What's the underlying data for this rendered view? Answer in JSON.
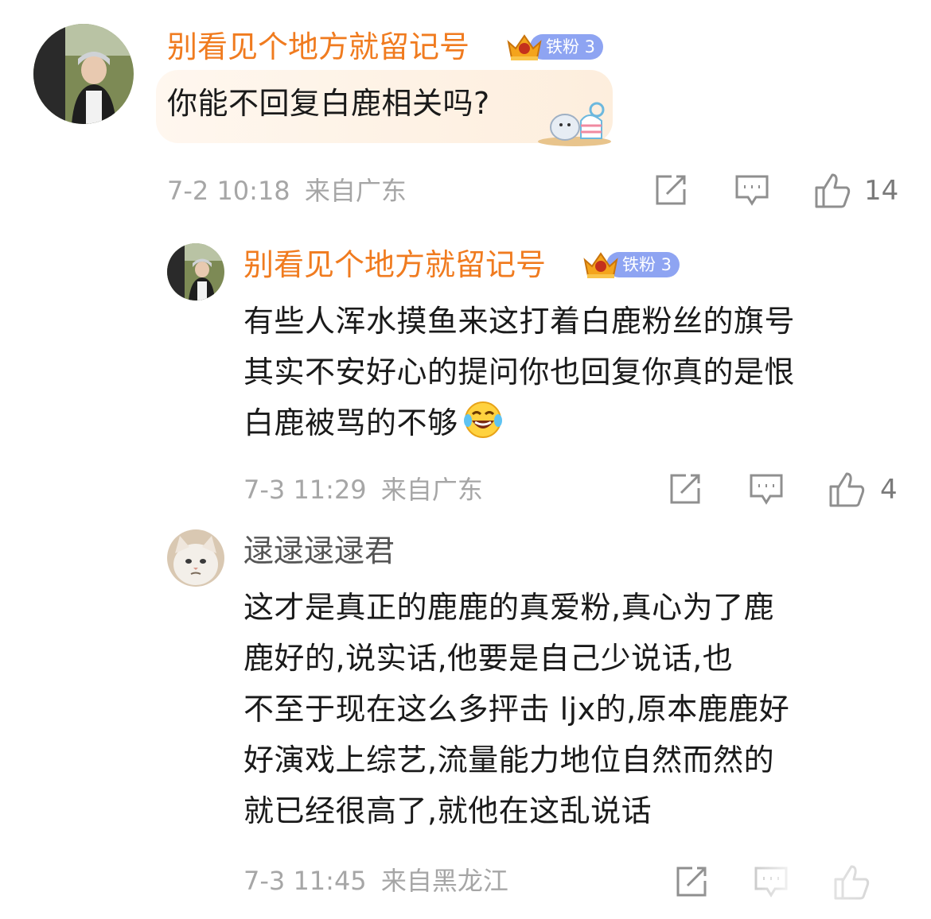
{
  "colors": {
    "username": "#f07b1f",
    "username_plain": "#555555",
    "badge_bg": "#8ea4f2",
    "meta": "#a6a6a6",
    "icon": "#9a9a9a"
  },
  "comments": [
    {
      "username": "别看见个地方就留记号",
      "badge": "铁粉 3",
      "lines": [
        "你能不回复白鹿相关吗?"
      ],
      "time": "7-2 10:18",
      "location": "来自广东",
      "likes": "14"
    },
    {
      "username": "别看见个地方就留记号",
      "badge": "铁粉 3",
      "lines": [
        "有些人浑水摸鱼来这打着白鹿粉丝的旗号",
        "其实不安好心的提问你也回复你真的是恨",
        "白鹿被骂的不够"
      ],
      "emoji": "laughing-crying-emoji",
      "time": "7-3 11:29",
      "location": "来自广东",
      "likes": "4"
    },
    {
      "username": "逯逯逯逯君",
      "lines": [
        "这才是真正的鹿鹿的真爱粉,真心为了鹿",
        "鹿好的,说实话,他要是自己少说话,也",
        "不至于现在这么多抨击 ljx的,原本鹿鹿好",
        "好演戏上综艺,流量能力地位自然而然的",
        "就已经很高了,就他在这乱说话"
      ],
      "time": "7-3 11:45",
      "location": "来自黑龙江",
      "likes": ""
    }
  ]
}
